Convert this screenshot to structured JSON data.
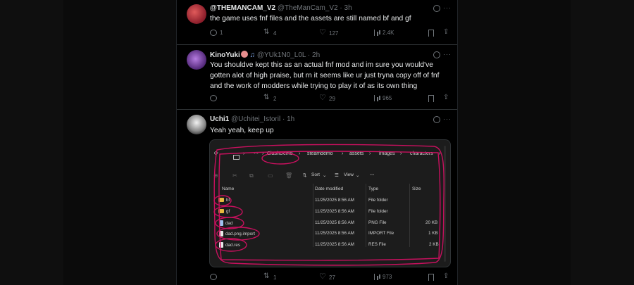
{
  "tweets": [
    {
      "name": "@THEMANCAM_V2",
      "handle": "@TheManCam_V2 · 3h",
      "text": "the game uses fnf files and the assets are still named bf and gf",
      "replies": "1",
      "reposts": "4",
      "likes": "127",
      "views": "2.4K"
    },
    {
      "name": "KinoYuki",
      "handle": "@YUk1N0_L0L · 2h",
      "text": "You shouldve kept this as an actual fnf mod and im sure you would've gotten alot of high praise, but rn it seems like ur just tryna copy off of fnf and the work of modders while trying to play it of as its own thing",
      "replies": "",
      "reposts": "2",
      "likes": "29",
      "views": "965"
    },
    {
      "name": "Uchi1",
      "handle": "@Uchitei_Istoril · 1h",
      "text": "Yeah yeah, keep up",
      "replies": "",
      "reposts": "1",
      "likes": "27",
      "views": "973"
    }
  ],
  "explorer": {
    "ellipsis": "···",
    "breadcrumb": [
      "ClashDemo",
      "steamdemo",
      "assets",
      "images",
      "characters"
    ],
    "toolbar": {
      "sort": "Sort",
      "view": "View",
      "more": "···"
    },
    "columns": [
      "Name",
      "Date modified",
      "Type",
      "Size"
    ],
    "rows": [
      {
        "name": "bf",
        "date": "11/25/2025 8:56 AM",
        "type": "File folder",
        "size": "",
        "kind": "folder"
      },
      {
        "name": "gf",
        "date": "11/25/2025 8:56 AM",
        "type": "File folder",
        "size": "",
        "kind": "folder"
      },
      {
        "name": "dad",
        "date": "11/25/2025 8:56 AM",
        "type": "PNG File",
        "size": "20 KB",
        "kind": "png"
      },
      {
        "name": "dad.png.import",
        "date": "11/25/2025 8:56 AM",
        "type": "IMPORT File",
        "size": "1 KB",
        "kind": "file"
      },
      {
        "name": "dad.res",
        "date": "11/25/2025 8:56 AM",
        "type": "RES File",
        "size": "2 KB",
        "kind": "file"
      }
    ]
  },
  "colors": {
    "annotation": "#c8105e",
    "accent": "#1d9bf0"
  }
}
